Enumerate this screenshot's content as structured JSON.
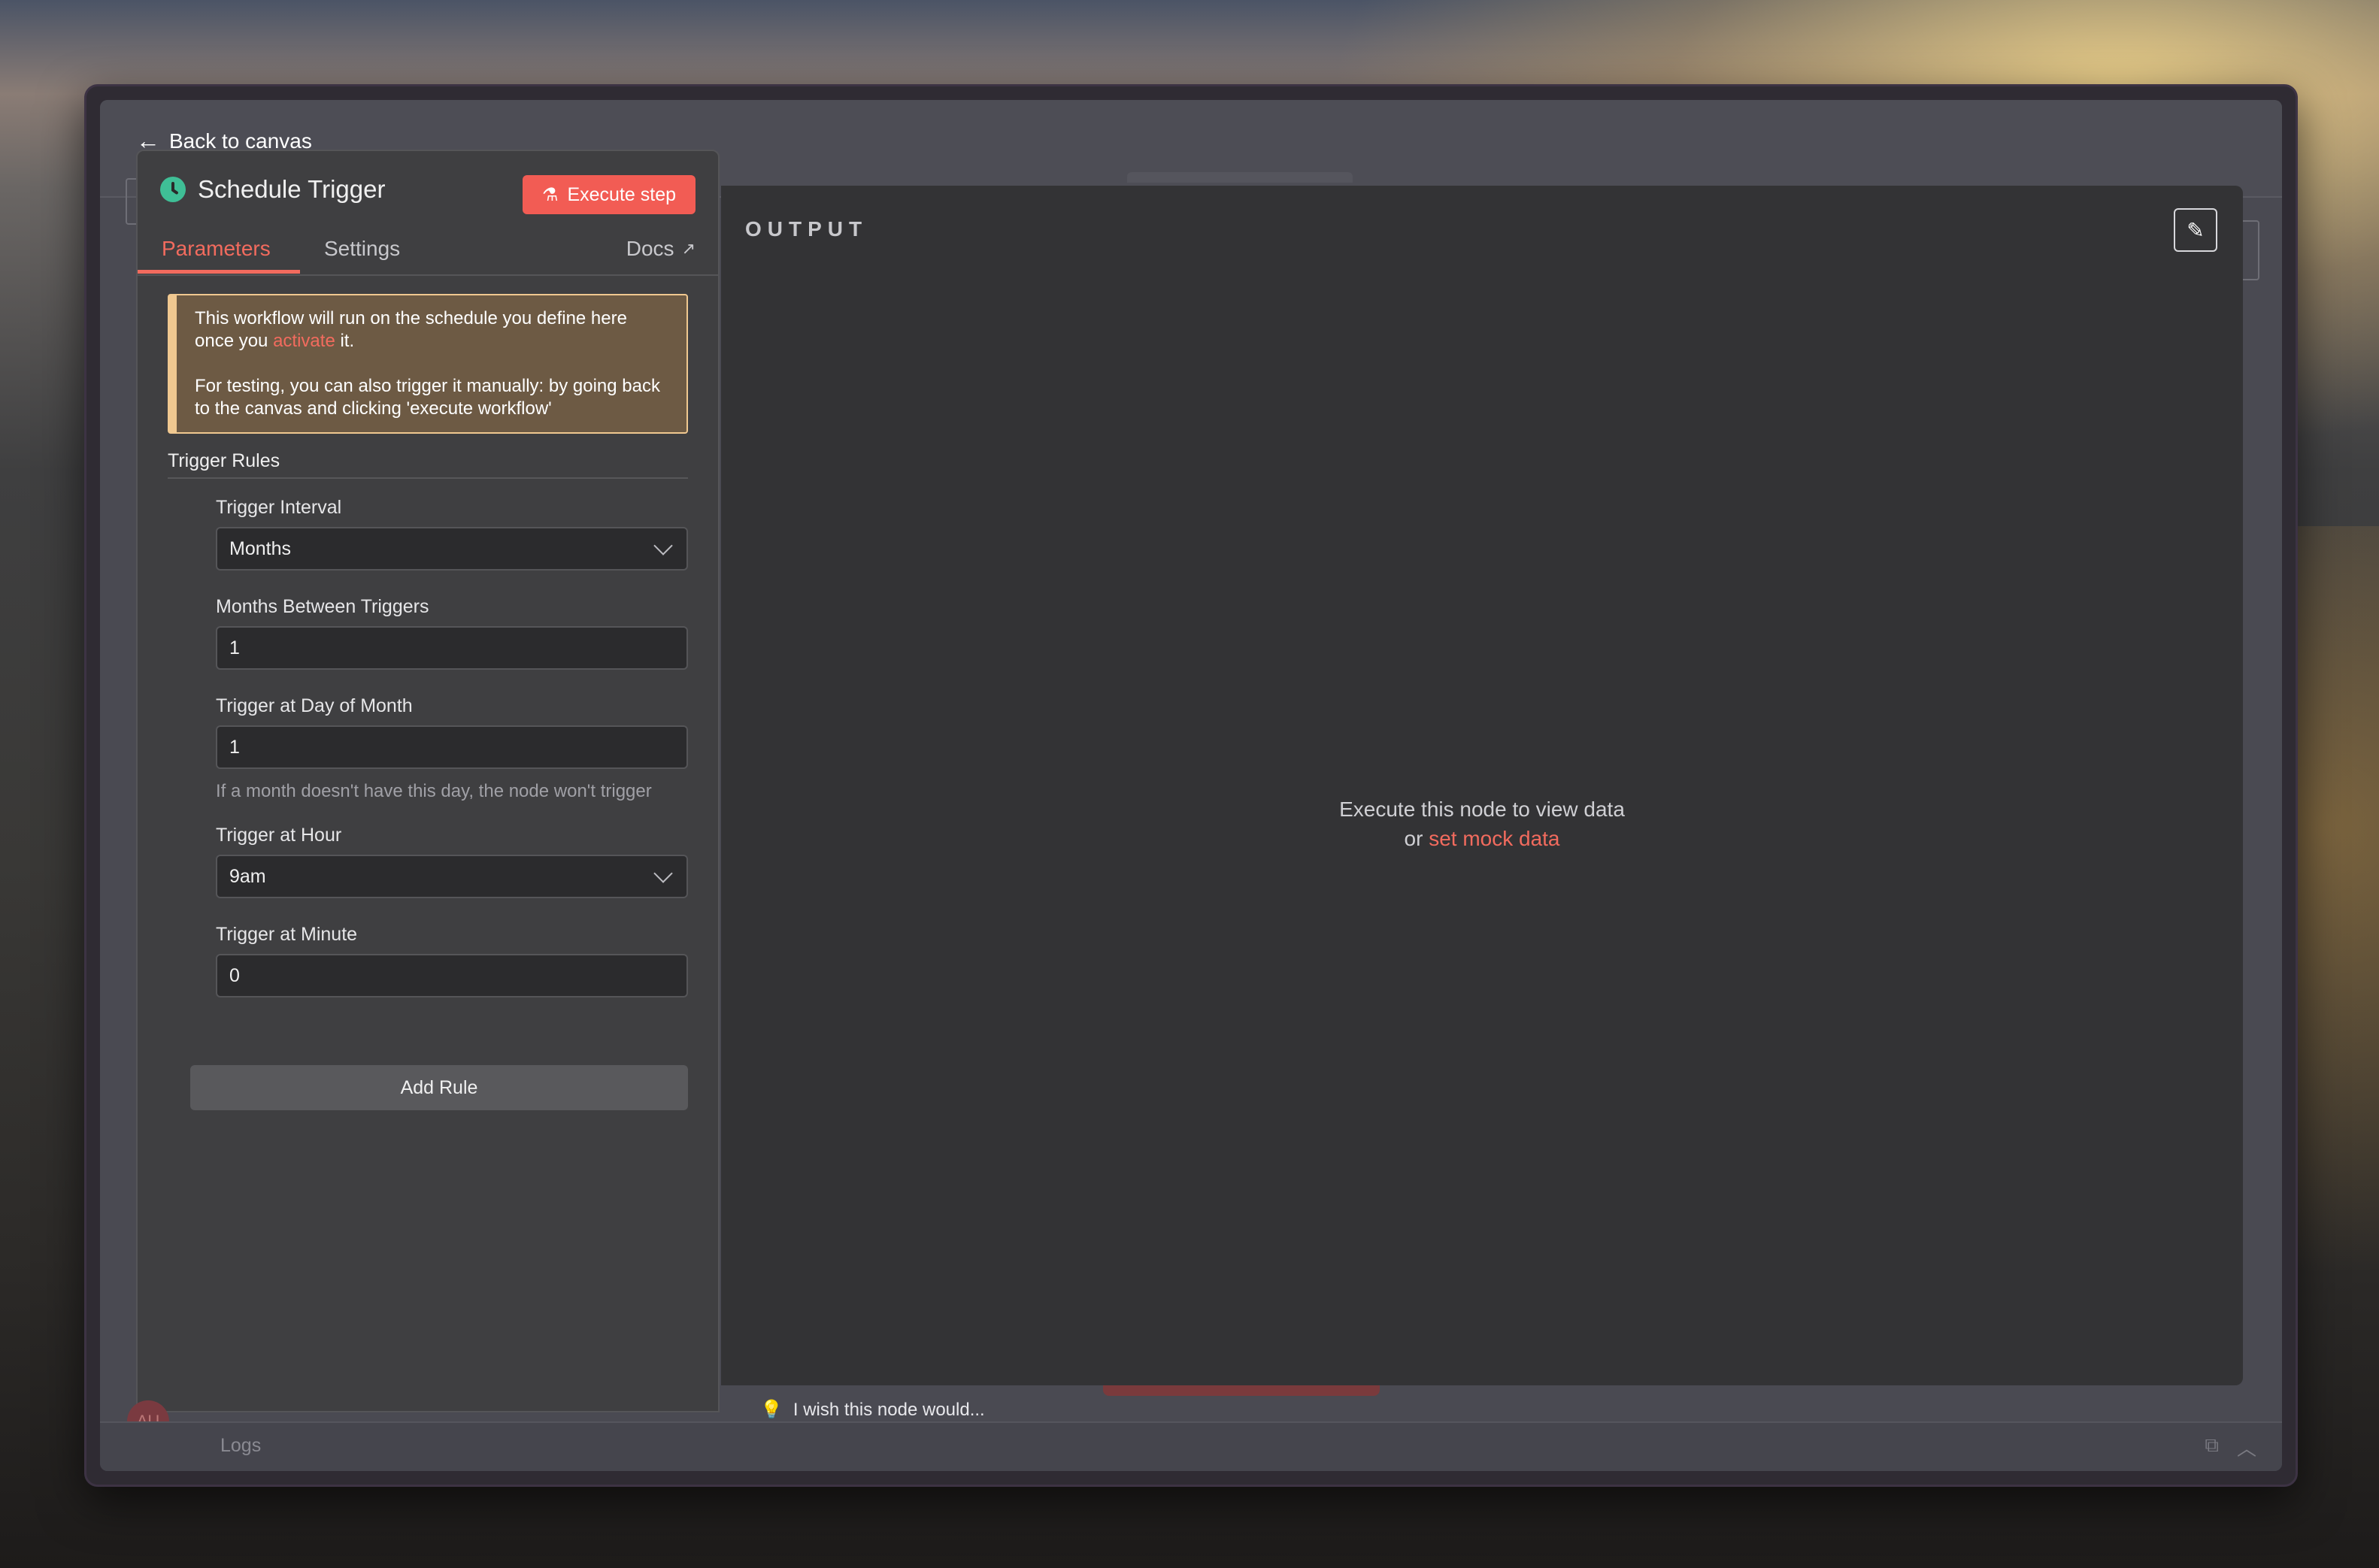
{
  "back_link": "Back to canvas",
  "node": {
    "title": "Schedule Trigger",
    "execute_label": "Execute step"
  },
  "tabs": {
    "parameters": "Parameters",
    "settings": "Settings",
    "docs": "Docs"
  },
  "notice": {
    "line1_before": "This workflow will run on the schedule you define here once you ",
    "line1_link": "activate",
    "line1_after": " it.",
    "line2": "For testing, you can also trigger it manually: by going back to the canvas and clicking 'execute workflow'"
  },
  "trigger_rules": {
    "section_title": "Trigger Rules",
    "interval_label": "Trigger Interval",
    "interval_value": "Months",
    "months_between_label": "Months Between Triggers",
    "months_between_value": "1",
    "day_of_month_label": "Trigger at Day of Month",
    "day_of_month_value": "1",
    "day_of_month_hint": "If a month doesn't have this day, the node won't trigger",
    "hour_label": "Trigger at Hour",
    "hour_value": "9am",
    "minute_label": "Trigger at Minute",
    "minute_value": "0",
    "add_rule": "Add Rule"
  },
  "output": {
    "label": "OUTPUT",
    "empty_line1": "Execute this node to view data",
    "empty_line2_prefix": "or ",
    "empty_line2_link": "set mock data"
  },
  "feedback": "I wish this node would...",
  "logs": "Logs",
  "avatar_initials": "AU",
  "colors": {
    "accent": "#f26b5e",
    "execute_button": "#f25c54",
    "node_icon": "#3fbf96",
    "notice_border": "#f0c890"
  },
  "icons": [
    "back-arrow-icon",
    "clock-icon",
    "flask-icon",
    "external-link-icon",
    "chevron-down-icon",
    "pencil-icon",
    "lightbulb-icon"
  ]
}
